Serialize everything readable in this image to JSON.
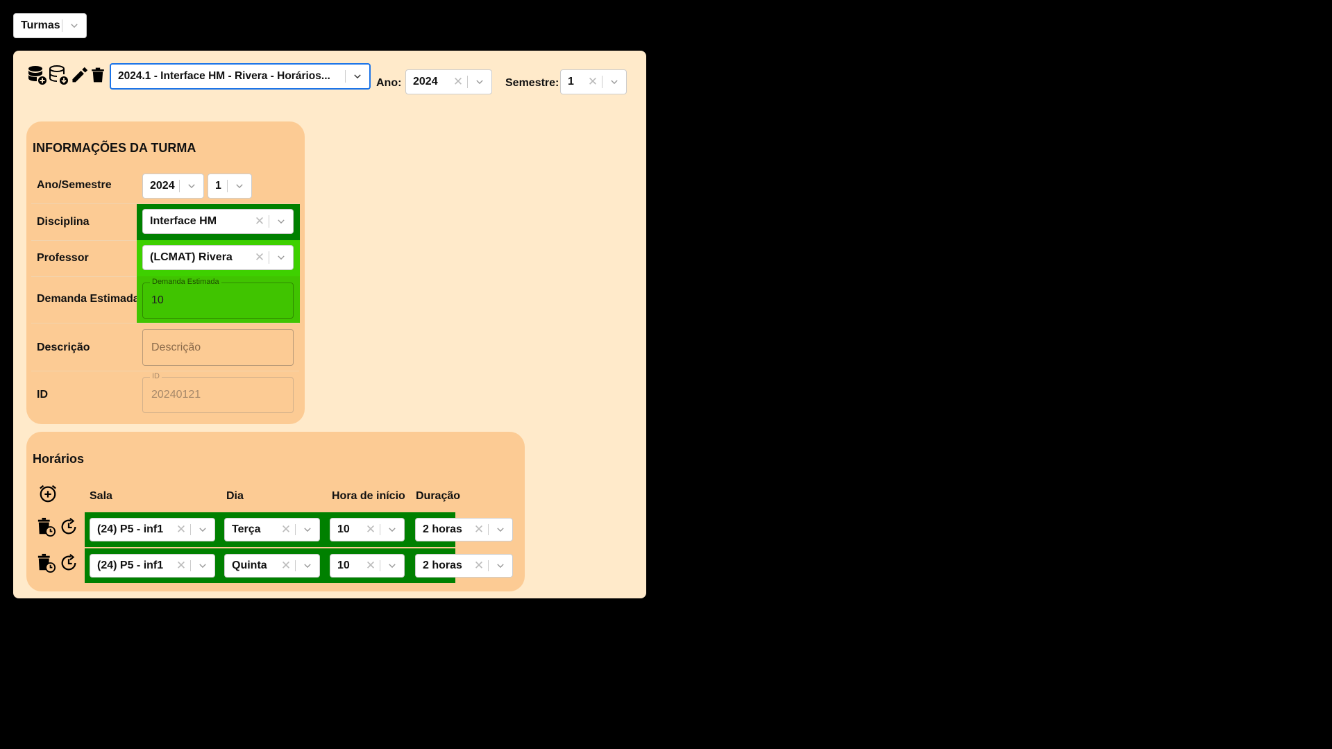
{
  "top": {
    "selector_value": "Turmas"
  },
  "toolbar": {
    "icons": [
      "database-add-icon",
      "database-download-icon",
      "edit-pencil-icon",
      "trash-icon"
    ],
    "turma_select_value": "2024.1 - Interface HM - Rivera - Horários...",
    "ano_label": "Ano:",
    "ano_value": "2024",
    "semestre_label": "Semestre:",
    "semestre_value": "1"
  },
  "info": {
    "title": "INFORMAÇÕES DA TURMA",
    "ano_semestre_label": "Ano/Semestre",
    "ano_value": "2024",
    "semestre_value": "1",
    "disciplina_label": "Disciplina",
    "disciplina_value": "Interface HM",
    "professor_label": "Professor",
    "professor_value": "(LCMAT) Rivera",
    "demanda_label": "Demanda Estimada",
    "demanda_legend": "Demanda Estimada",
    "demanda_value": "10",
    "descricao_label": "Descrição",
    "descricao_placeholder": "Descrição",
    "id_label": "ID",
    "id_legend": "ID",
    "id_value": "20240121"
  },
  "horarios": {
    "title": "Horários",
    "columns": {
      "sala": "Sala",
      "dia": "Dia",
      "hora": "Hora de início",
      "duracao": "Duração"
    },
    "rows": [
      {
        "sala": "(24) P5 - inf1",
        "dia": "Terça",
        "hora": "10",
        "duracao": "2 horas"
      },
      {
        "sala": "(24) P5 - inf1",
        "dia": "Quinta",
        "hora": "10",
        "duracao": "2 horas"
      }
    ]
  },
  "colors": {
    "panel_bg": "#ffeaca",
    "section_bg": "#fccb94",
    "dark_green": "#008000",
    "bright_green": "#40c400",
    "lime_green": "#3ed000",
    "focus_border": "#1a73e8"
  }
}
